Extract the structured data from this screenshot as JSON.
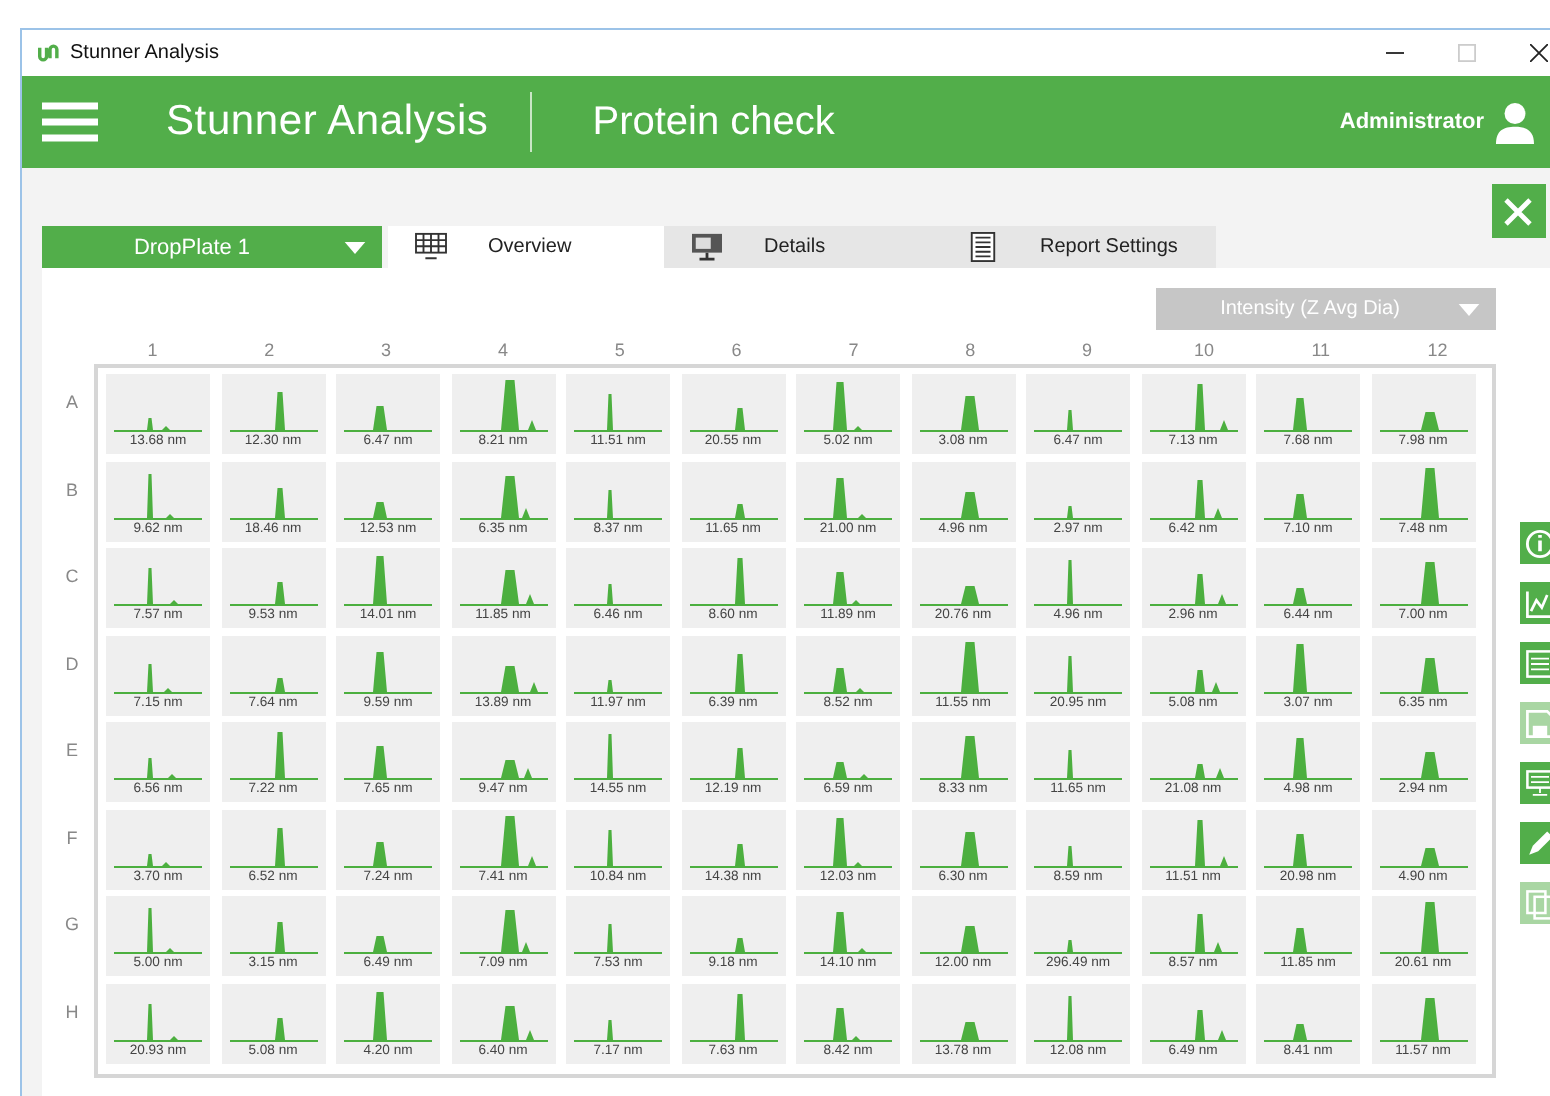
{
  "window": {
    "title": "Stunner Analysis"
  },
  "header": {
    "app_name": "Stunner Analysis",
    "page_title": "Protein check",
    "user": "Administrator"
  },
  "plate_dropdown": {
    "value": "DropPlate 1"
  },
  "tabs": [
    {
      "label": "Overview",
      "kind": "grid",
      "selected": true
    },
    {
      "label": "Details",
      "kind": "monitor",
      "selected": false
    },
    {
      "label": "Report Settings",
      "kind": "document",
      "selected": false
    }
  ],
  "view_dropdown": {
    "value": "Intensity (Z Avg Dia)"
  },
  "columns": [
    "1",
    "2",
    "3",
    "4",
    "5",
    "6",
    "7",
    "8",
    "9",
    "10",
    "11",
    "12"
  ],
  "rows": [
    {
      "label": "A",
      "cells": [
        "13.68 nm",
        "12.30 nm",
        "6.47 nm",
        "8.21 nm",
        "11.51 nm",
        "20.55 nm",
        "5.02 nm",
        "3.08 nm",
        "6.47 nm",
        "7.13 nm",
        "7.68 nm",
        "7.98 nm"
      ]
    },
    {
      "label": "B",
      "cells": [
        "9.62 nm",
        "18.46 nm",
        "12.53 nm",
        "6.35 nm",
        "8.37 nm",
        "11.65 nm",
        "21.00 nm",
        "4.96 nm",
        "2.97 nm",
        "6.42 nm",
        "7.10 nm",
        "7.48 nm"
      ]
    },
    {
      "label": "C",
      "cells": [
        "7.57 nm",
        "9.53 nm",
        "14.01 nm",
        "11.85 nm",
        "6.46 nm",
        "8.60 nm",
        "11.89 nm",
        "20.76 nm",
        "4.96 nm",
        "2.96 nm",
        "6.44 nm",
        "7.00 nm"
      ]
    },
    {
      "label": "D",
      "cells": [
        "7.15 nm",
        "7.64 nm",
        "9.59 nm",
        "13.89 nm",
        "11.97 nm",
        "6.39 nm",
        "8.52 nm",
        "11.55 nm",
        "20.95 nm",
        "5.08 nm",
        "3.07 nm",
        "6.35 nm"
      ]
    },
    {
      "label": "E",
      "cells": [
        "6.56 nm",
        "7.22 nm",
        "7.65 nm",
        "9.47 nm",
        "14.55 nm",
        "12.19 nm",
        "6.59 nm",
        "8.33 nm",
        "11.65 nm",
        "21.08 nm",
        "4.98 nm",
        "2.94 nm"
      ]
    },
    {
      "label": "F",
      "cells": [
        "3.70 nm",
        "6.52 nm",
        "7.24 nm",
        "7.41 nm",
        "10.84 nm",
        "14.38 nm",
        "12.03 nm",
        "6.30 nm",
        "8.59 nm",
        "11.51 nm",
        "20.98 nm",
        "4.90 nm"
      ]
    },
    {
      "label": "G",
      "cells": [
        "5.00 nm",
        "3.15 nm",
        "6.49 nm",
        "7.09 nm",
        "7.53 nm",
        "9.18 nm",
        "14.10 nm",
        "12.00 nm",
        "296.49 nm",
        "8.57 nm",
        "11.85 nm",
        "20.61 nm"
      ]
    },
    {
      "label": "H",
      "cells": [
        "20.93 nm",
        "5.08 nm",
        "4.20 nm",
        "6.40 nm",
        "7.17 nm",
        "7.63 nm",
        "8.42 nm",
        "13.78 nm",
        "12.08 nm",
        "6.49 nm",
        "8.41 nm",
        "11.57 nm"
      ]
    }
  ],
  "side_tools": [
    {
      "kind": "info",
      "disabled": false
    },
    {
      "kind": "chart",
      "disabled": false
    },
    {
      "kind": "list",
      "disabled": false
    },
    {
      "kind": "save",
      "disabled": true
    },
    {
      "kind": "monitor",
      "disabled": false
    },
    {
      "kind": "pencil",
      "disabled": false
    },
    {
      "kind": "copy",
      "disabled": true
    }
  ]
}
